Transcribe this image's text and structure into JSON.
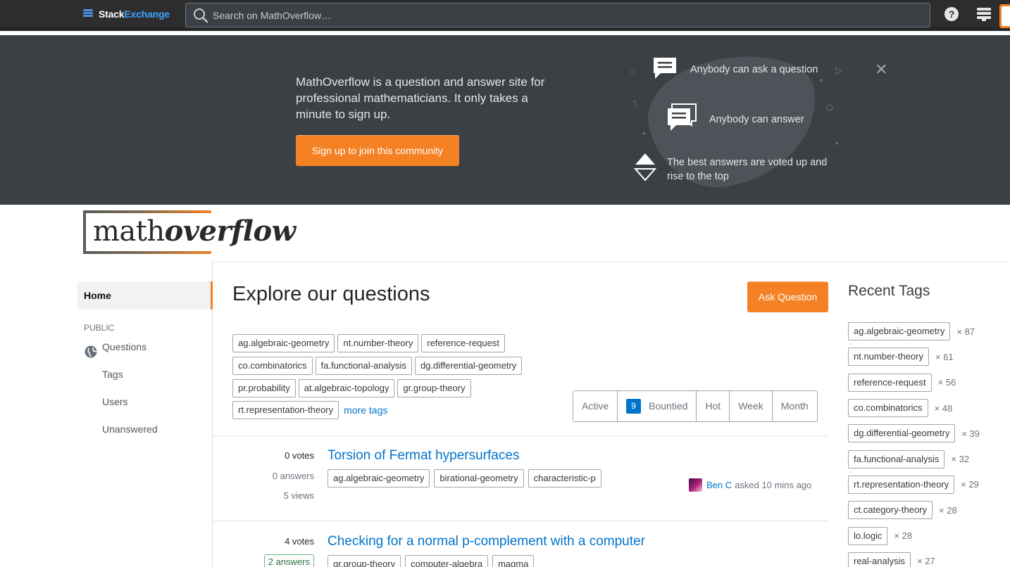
{
  "topbar": {
    "brand_stack": "Stack",
    "brand_exchange": "Exchange",
    "search_placeholder": "Search on MathOverflow…"
  },
  "banner": {
    "intro": "MathOverflow is a question and answer site for professional mathematicians. It only takes a minute to sign up.",
    "signup_label": "Sign up to join this community",
    "feature_1": "Anybody can ask a question",
    "feature_2": "Anybody can answer",
    "feature_3": "The best answers are voted up and rise to the top"
  },
  "logo": {
    "plain": "math",
    "bold": "overflow"
  },
  "nav": {
    "home": "Home",
    "public": "PUBLIC",
    "items": [
      "Questions",
      "Tags",
      "Users",
      "Unanswered"
    ]
  },
  "main": {
    "title": "Explore our questions",
    "ask_label": "Ask Question",
    "tag_rows": [
      [
        "ag.algebraic-geometry",
        "nt.number-theory",
        "reference-request"
      ],
      [
        "co.combinatorics",
        "fa.functional-analysis",
        "dg.differential-geometry"
      ],
      [
        "pr.probability",
        "at.algebraic-topology",
        "gr.group-theory"
      ],
      [
        "rt.representation-theory"
      ]
    ],
    "more_tags": "more tags",
    "filters": {
      "active": "Active",
      "bountied_count": "9",
      "bountied": "Bountied",
      "hot": "Hot",
      "week": "Week",
      "month": "Month"
    }
  },
  "questions": [
    {
      "votes": "0 votes",
      "answers": "0 answers",
      "views": "5 views",
      "title": "Torsion of Fermat hypersurfaces",
      "tags": [
        "ag.algebraic-geometry",
        "birational-geometry",
        "characteristic-p"
      ],
      "user": "Ben C",
      "asked": "asked 10 mins ago"
    },
    {
      "votes": "4 votes",
      "answers": "2 answers",
      "title": "Checking for a normal p-complement with a computer",
      "tags": [
        "gr.group-theory",
        "computer-algebra",
        "magma"
      ]
    }
  ],
  "recent_tags": {
    "title": "Recent Tags",
    "items": [
      {
        "name": "ag.algebraic-geometry",
        "count": "× 87"
      },
      {
        "name": "nt.number-theory",
        "count": "× 61"
      },
      {
        "name": "reference-request",
        "count": "× 56"
      },
      {
        "name": "co.combinatorics",
        "count": "× 48"
      },
      {
        "name": "dg.differential-geometry",
        "count": "× 39"
      },
      {
        "name": "fa.functional-analysis",
        "count": "× 32"
      },
      {
        "name": "rt.representation-theory",
        "count": "× 29"
      },
      {
        "name": "ct.category-theory",
        "count": "× 28"
      },
      {
        "name": "lo.logic",
        "count": "× 28"
      },
      {
        "name": "real-analysis",
        "count": "× 27"
      }
    ]
  },
  "colors": {
    "accent": "#f48225",
    "link": "#0074cc",
    "topbar": "#2d2d2d",
    "banner": "#3b4045"
  }
}
